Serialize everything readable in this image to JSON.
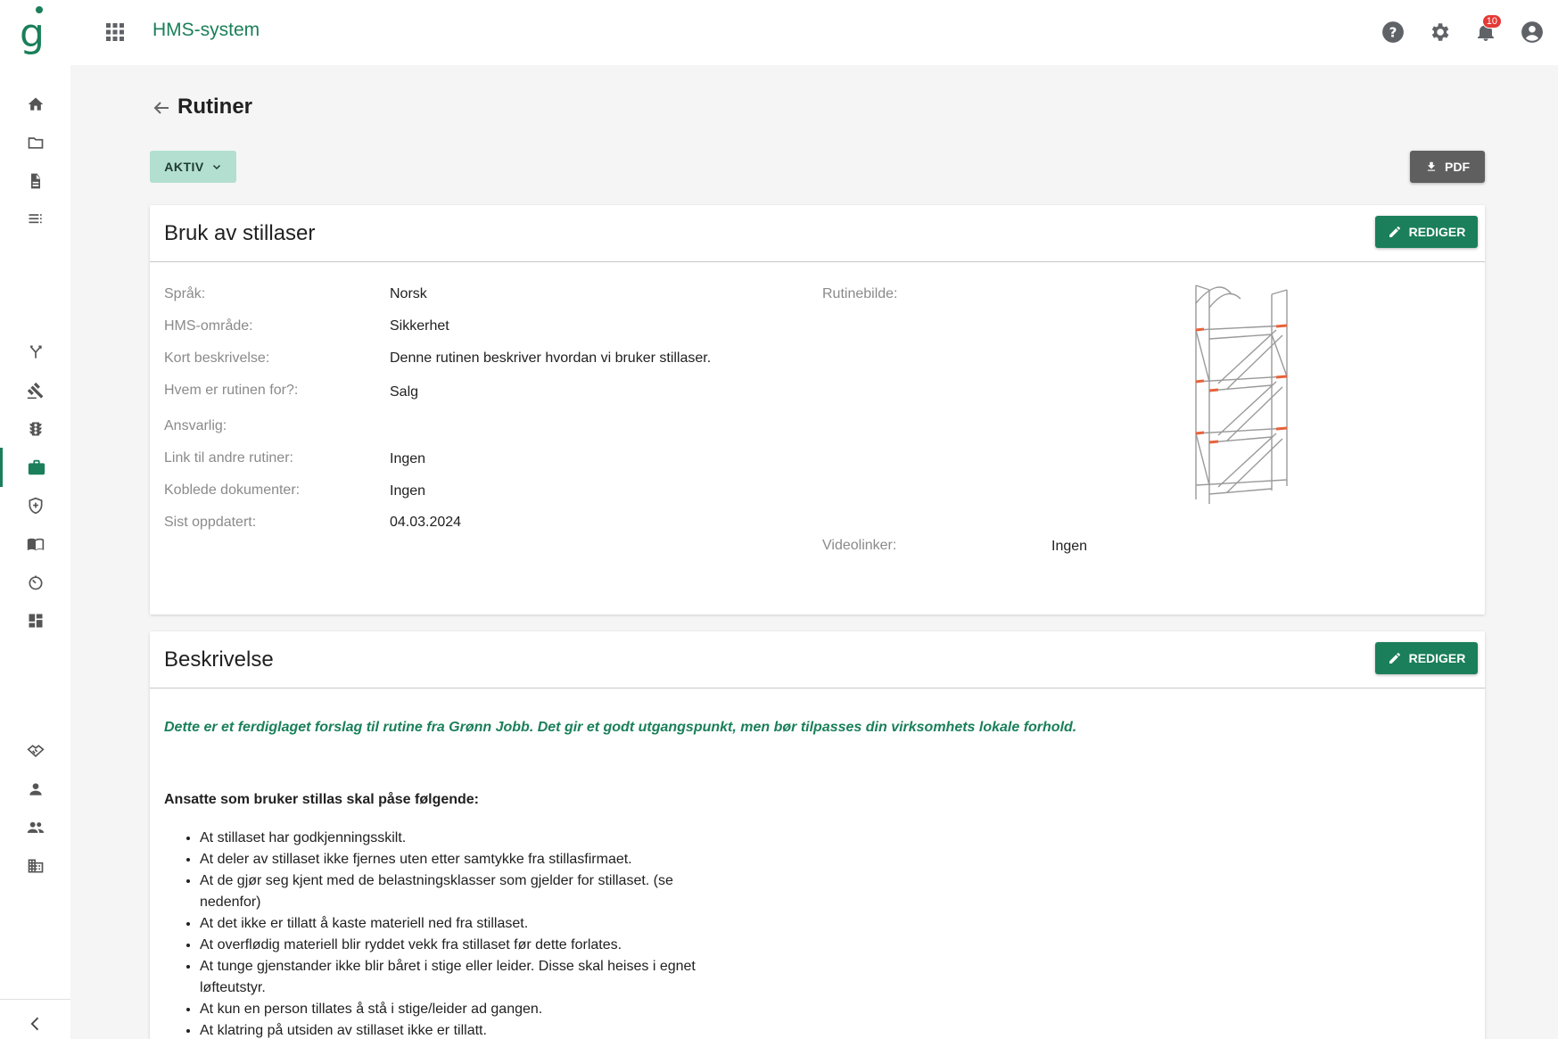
{
  "header": {
    "logo_letter": "g",
    "app_title": "HMS-system",
    "notification_count": "10",
    "icons": [
      "apps-icon",
      "help-icon",
      "settings-icon",
      "bell-icon",
      "account-icon"
    ]
  },
  "sidebar": {
    "items": [
      "home-icon",
      "folder-icon",
      "document-icon",
      "list-icon",
      "fork-icon",
      "gavel-icon",
      "traffic-light-icon",
      "briefcase-icon",
      "health-shield-icon",
      "book-icon",
      "timer-icon",
      "dashboard-icon",
      "handshake-icon",
      "person-icon",
      "people-icon",
      "building-icon",
      "collapse-icon"
    ],
    "active": "briefcase-icon"
  },
  "page": {
    "title": "Rutiner",
    "status_label": "AKTIV",
    "pdf_label": "PDF"
  },
  "details_card": {
    "title": "Bruk av stillaser",
    "edit_label": "REDIGER",
    "fields": [
      {
        "label": "Språk:",
        "value": "Norsk"
      },
      {
        "label": "HMS-område:",
        "value": "Sikkerhet"
      },
      {
        "label": "Kort beskrivelse:",
        "value": "Denne rutinen beskriver hvordan vi bruker stillaser."
      },
      {
        "label": "Hvem er rutinen for?:",
        "value": "Salg"
      },
      {
        "label": "Ansvarlig:",
        "value": ""
      },
      {
        "label": "Link til andre rutiner:",
        "value": "Ingen"
      },
      {
        "label": "Koblede dokumenter:",
        "value": "Ingen"
      },
      {
        "label": "Sist oppdatert:",
        "value": "04.03.2024"
      }
    ],
    "image_label": "Rutinebilde:",
    "video_label": "Videolinker:",
    "video_value": "Ingen"
  },
  "description_card": {
    "title": "Beskrivelse",
    "edit_label": "REDIGER",
    "intro": "Dette er et ferdiglaget forslag til rutine fra Grønn Jobb. Det gir et godt utgangspunkt, men bør tilpasses din virksomhets lokale forhold.",
    "sub_heading": "Ansatte som bruker stillas skal påse følgende:",
    "bullets": [
      "At stillaset har godkjenningsskilt.",
      "At deler av stillaset ikke fjernes uten etter samtykke fra stillasfirmaet.",
      "At de gjør seg kjent med de belastningsklasser som gjelder for stillaset. (se nedenfor)",
      "At det ikke er tillatt å kaste materiell ned fra stillaset.",
      "At overflødig materiell blir ryddet vekk fra stillaset før dette forlates.",
      "At tunge gjenstander ikke blir båret i stige eller leider. Disse skal heises i egnet løfteutstyr.",
      "At kun en person tillates å stå i stige/leider ad gangen.",
      "At klatring på utsiden av stillaset ikke er tillatt."
    ]
  },
  "colors": {
    "brand": "#1a7f5a",
    "status_bg": "#b2dfd0",
    "pdf_bg": "#5f5f5f",
    "badge": "#e53935"
  }
}
